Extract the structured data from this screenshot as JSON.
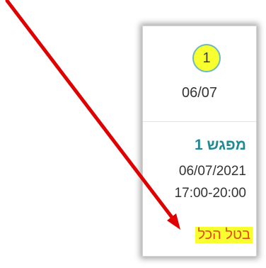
{
  "card": {
    "badge_count": "1",
    "date_short": "06/07",
    "meeting_title": "מפגש 1",
    "meeting_date": "06/07/2021",
    "meeting_time": "17:00-20:00",
    "cancel_all_label": "בטל הכל"
  },
  "colors": {
    "highlight": "#f7ff2e",
    "title_teal": "#1f8a94",
    "cancel_link": "#e64a19",
    "arrow_red": "#e00000"
  },
  "icons": {
    "annotation": "red-arrow-icon"
  }
}
